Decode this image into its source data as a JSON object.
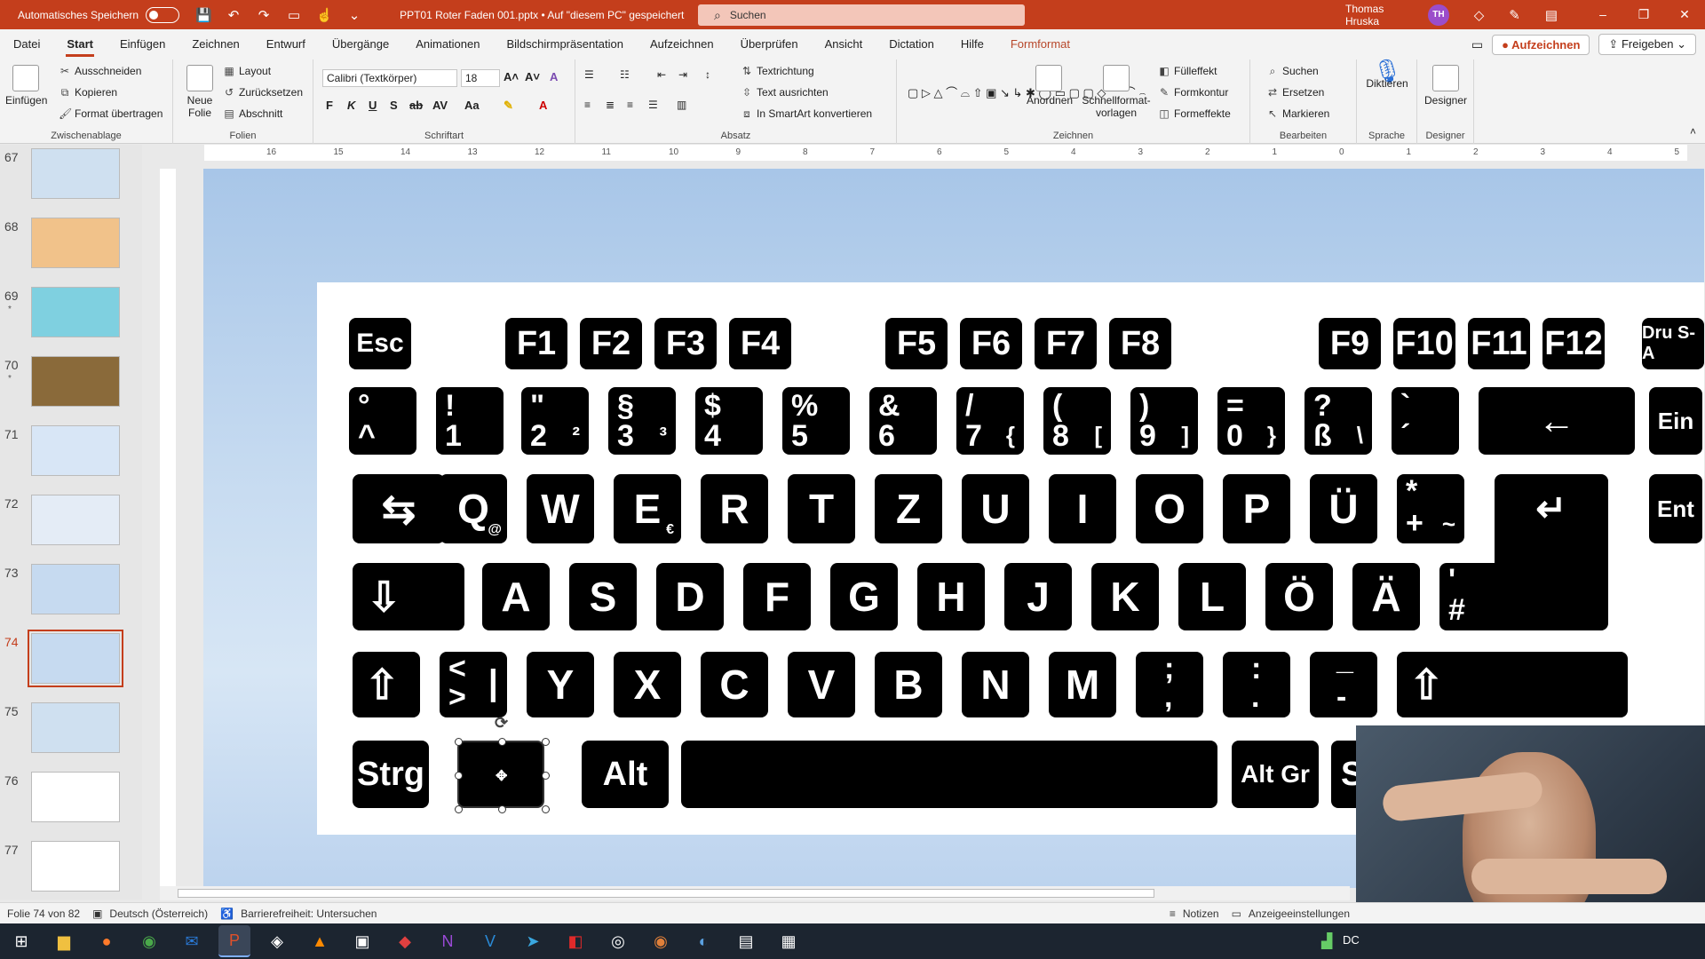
{
  "titlebar": {
    "autosave_label": "Automatisches Speichern",
    "doc_title": "PPT01 Roter Faden 001.pptx • Auf \"diesem PC\" gespeichert",
    "search_placeholder": "Suchen",
    "user_name": "Thomas Hruska",
    "user_initials": "TH"
  },
  "menu": {
    "items": [
      "Datei",
      "Start",
      "Einfügen",
      "Zeichnen",
      "Entwurf",
      "Übergänge",
      "Animationen",
      "Bildschirmpräsentation",
      "Aufzeichnen",
      "Überprüfen",
      "Ansicht",
      "Dictation",
      "Hilfe",
      "Formformat"
    ],
    "record_button": "Aufzeichnen",
    "share_button": "Freigeben"
  },
  "ribbon": {
    "clipboard": {
      "label": "Zwischenablage",
      "paste": "Einfügen",
      "cut": "Ausschneiden",
      "copy": "Kopieren",
      "format_painter": "Format übertragen"
    },
    "slides": {
      "label": "Folien",
      "new_slide_line1": "Neue",
      "new_slide_line2": "Folie",
      "layout": "Layout",
      "reset": "Zurücksetzen",
      "section": "Abschnitt"
    },
    "font": {
      "label": "Schriftart",
      "font_name": "Calibri (Textkörper)",
      "font_size": "18"
    },
    "paragraph": {
      "label": "Absatz",
      "text_direction": "Textrichtung",
      "align_text": "Text ausrichten",
      "smartart": "In SmartArt konvertieren"
    },
    "drawing": {
      "label": "Zeichnen",
      "arrange": "Anordnen",
      "quick_styles_line1": "Schnellformat-",
      "quick_styles_line2": "vorlagen",
      "fill": "Fülleffekt",
      "outline": "Formkontur",
      "effects": "Formeffekte"
    },
    "editing": {
      "label": "Bearbeiten",
      "find": "Suchen",
      "replace": "Ersetzen",
      "select": "Markieren"
    },
    "voice": {
      "label": "Sprache",
      "dictate": "Diktieren"
    },
    "designer": {
      "label": "Designer",
      "designer": "Designer"
    }
  },
  "ruler_numbers": [
    "16",
    "15",
    "14",
    "13",
    "12",
    "11",
    "10",
    "9",
    "8",
    "7",
    "6",
    "5",
    "4",
    "3",
    "2",
    "1",
    "0",
    "1",
    "2",
    "3",
    "4",
    "5"
  ],
  "slides": [
    {
      "num": "67",
      "star": false,
      "bg": "#cfe0f0"
    },
    {
      "num": "68",
      "star": false,
      "bg": "#f1c28a"
    },
    {
      "num": "69",
      "star": true,
      "bg": "#7fd0e0"
    },
    {
      "num": "70",
      "star": true,
      "bg": "#8a6a3a"
    },
    {
      "num": "71",
      "star": false,
      "bg": "#d8e6f6"
    },
    {
      "num": "72",
      "star": false,
      "bg": "#e4ecf6"
    },
    {
      "num": "73",
      "star": false,
      "bg": "#c6daf0"
    },
    {
      "num": "74",
      "star": false,
      "bg": "#c6daf0"
    },
    {
      "num": "75",
      "star": false,
      "bg": "#cfe0f0"
    },
    {
      "num": "76",
      "star": false,
      "bg": "#ffffff"
    },
    {
      "num": "77",
      "star": false,
      "bg": "#ffffff"
    }
  ],
  "keyboard": {
    "row0": [
      "Esc",
      "F1",
      "F2",
      "F3",
      "F4",
      "F5",
      "F6",
      "F7",
      "F8",
      "F9",
      "F10",
      "F11",
      "F12",
      "Dru S-A"
    ],
    "row1": [
      [
        "°",
        "^"
      ],
      [
        "!",
        "1"
      ],
      [
        "\"",
        "2",
        "²"
      ],
      [
        "§",
        "3",
        "³"
      ],
      [
        "$",
        "4"
      ],
      [
        "%",
        "5"
      ],
      [
        "&",
        "6"
      ],
      [
        "/",
        "7",
        "{"
      ],
      [
        "(",
        "8",
        "["
      ],
      [
        ")",
        "9",
        "]"
      ],
      [
        "=",
        "0",
        "}"
      ],
      [
        "?",
        "ß",
        "\\"
      ],
      [
        "`",
        "´"
      ],
      [
        "←",
        ""
      ],
      [
        "Ein",
        ""
      ]
    ],
    "row2": [
      "⇆",
      "Q",
      "W",
      "E",
      "R",
      "T",
      "Z",
      "U",
      "I",
      "O",
      "P",
      "Ü",
      "+",
      "↵",
      "Ent"
    ],
    "row2_sub": {
      "Q": "@",
      "E": "€",
      "+": "*",
      "+b": "~"
    },
    "row3": [
      "⇩",
      "A",
      "S",
      "D",
      "F",
      "G",
      "H",
      "J",
      "K",
      "L",
      "Ö",
      "Ä",
      "#"
    ],
    "row3_sub": {
      "#": "'"
    },
    "row4": [
      "⇧",
      "<",
      "Y",
      "X",
      "C",
      "V",
      "B",
      "N",
      "M",
      ";",
      ":",
      "_",
      "⇧"
    ],
    "row4_sub": {
      "<": ">",
      "|": "|",
      ";": ",",
      ":": ".",
      "_": "-"
    },
    "row5": [
      "Strg",
      "",
      "Alt",
      "",
      "Alt Gr",
      "St"
    ]
  },
  "statusbar": {
    "slide_info": "Folie 74 von 82",
    "language": "Deutsch (Österreich)",
    "accessibility": "Barrierefreiheit: Untersuchen",
    "notes": "Notizen",
    "display_settings": "Anzeigeeinstellungen"
  },
  "taskbar": {
    "apps": [
      "windows-start",
      "file-explorer",
      "firefox",
      "chrome",
      "outlook",
      "powerpoint",
      "app-7",
      "vlc",
      "app-9",
      "app-10",
      "onenote",
      "visio",
      "telegram",
      "app-14",
      "app-15",
      "app-16",
      "app-17",
      "app-18",
      "app-19"
    ],
    "tray_text": "DC"
  },
  "colors": {
    "accent": "#c43e1c",
    "key_bg": "#000000",
    "key_fg": "#ffffff"
  }
}
